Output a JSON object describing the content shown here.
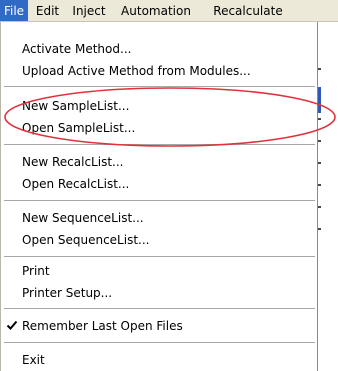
{
  "menubar": {
    "items": [
      {
        "label": "File",
        "active": true
      },
      {
        "label": "Edit",
        "active": false
      },
      {
        "label": "Inject",
        "active": false
      },
      {
        "label": "Automation",
        "active": false
      },
      {
        "label": "Recalculate",
        "active": false
      }
    ]
  },
  "file_menu": {
    "activate_method": "Activate Method...",
    "upload_active_method": "Upload Active Method from Modules...",
    "new_samplelist": "New SampleList...",
    "open_samplelist": "Open SampleList...",
    "new_recalclist": "New RecalcList...",
    "open_recalclist": "Open RecalcList...",
    "new_sequencelist": "New SequenceList...",
    "open_sequencelist": "Open SequenceList...",
    "print": "Print",
    "printer_setup": "Printer Setup...",
    "remember_last_open_files": "Remember Last Open Files",
    "remember_checked": true,
    "exit": "Exit"
  },
  "annotation": {
    "color": "#e0323c",
    "icon": "checkmark-icon"
  },
  "colors": {
    "menubar_bg": "#ece9d8",
    "active_bg": "#316ac5",
    "active_text": "#ffffff"
  }
}
